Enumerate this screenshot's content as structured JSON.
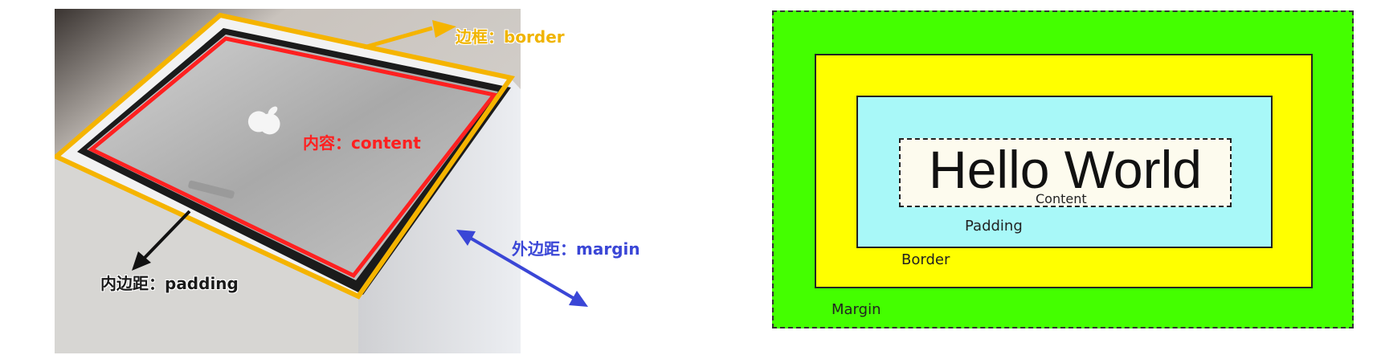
{
  "photo_labels": {
    "border": "边框：border",
    "content": "内容：content",
    "padding": "内边距：padding",
    "margin": "外边距：margin"
  },
  "box_model": {
    "content_text": "Hello World",
    "content_label": "Content",
    "padding_label": "Padding",
    "border_label": "Border",
    "margin_label": "Margin"
  },
  "colors": {
    "margin_green": "#44ff00",
    "border_yellow": "#ffff00",
    "padding_cyan": "#a8f8f8",
    "content_bg": "#fdfbee",
    "photo_border_outline": "#f5b400",
    "photo_content_outline": "#ff2020",
    "margin_arrow": "#3a46d6"
  },
  "icons": {
    "laptop_logo": "apple-logo-icon"
  }
}
